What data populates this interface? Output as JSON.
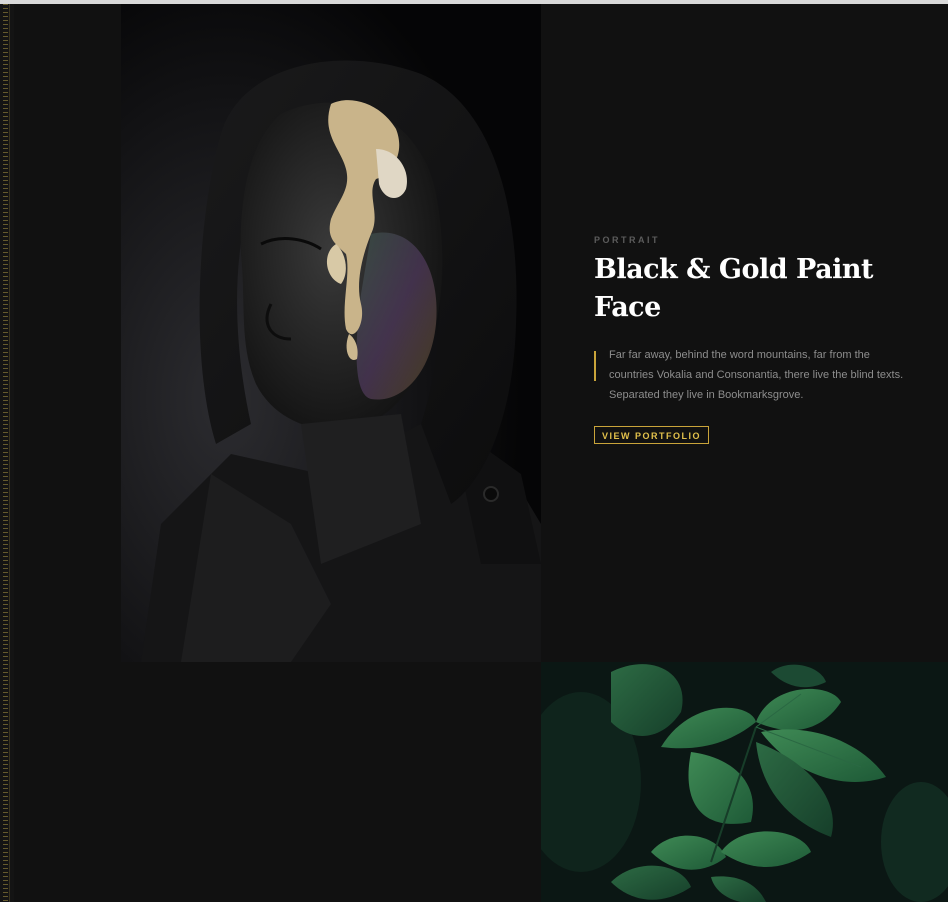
{
  "gallery": {
    "left_rail_icon": "ruler-ticks-icon",
    "portrait_image": "hooded-face-black-gold-paint-photo",
    "leaf_image": "green-leaves-photo"
  },
  "project": {
    "category": "PORTRAIT",
    "title": "Black & Gold Paint Face",
    "description": "Far far away, behind the word mountains, far from the countries Vokalia and Consonantia, there live the blind texts. Separated they live in Bookmarksgrove.",
    "button_label": "VIEW PORTFOLIO"
  },
  "colors": {
    "background": "#111111",
    "accent_gold": "#c9a43a",
    "title": "#ffffff",
    "body_text": "#8d8d8d"
  }
}
